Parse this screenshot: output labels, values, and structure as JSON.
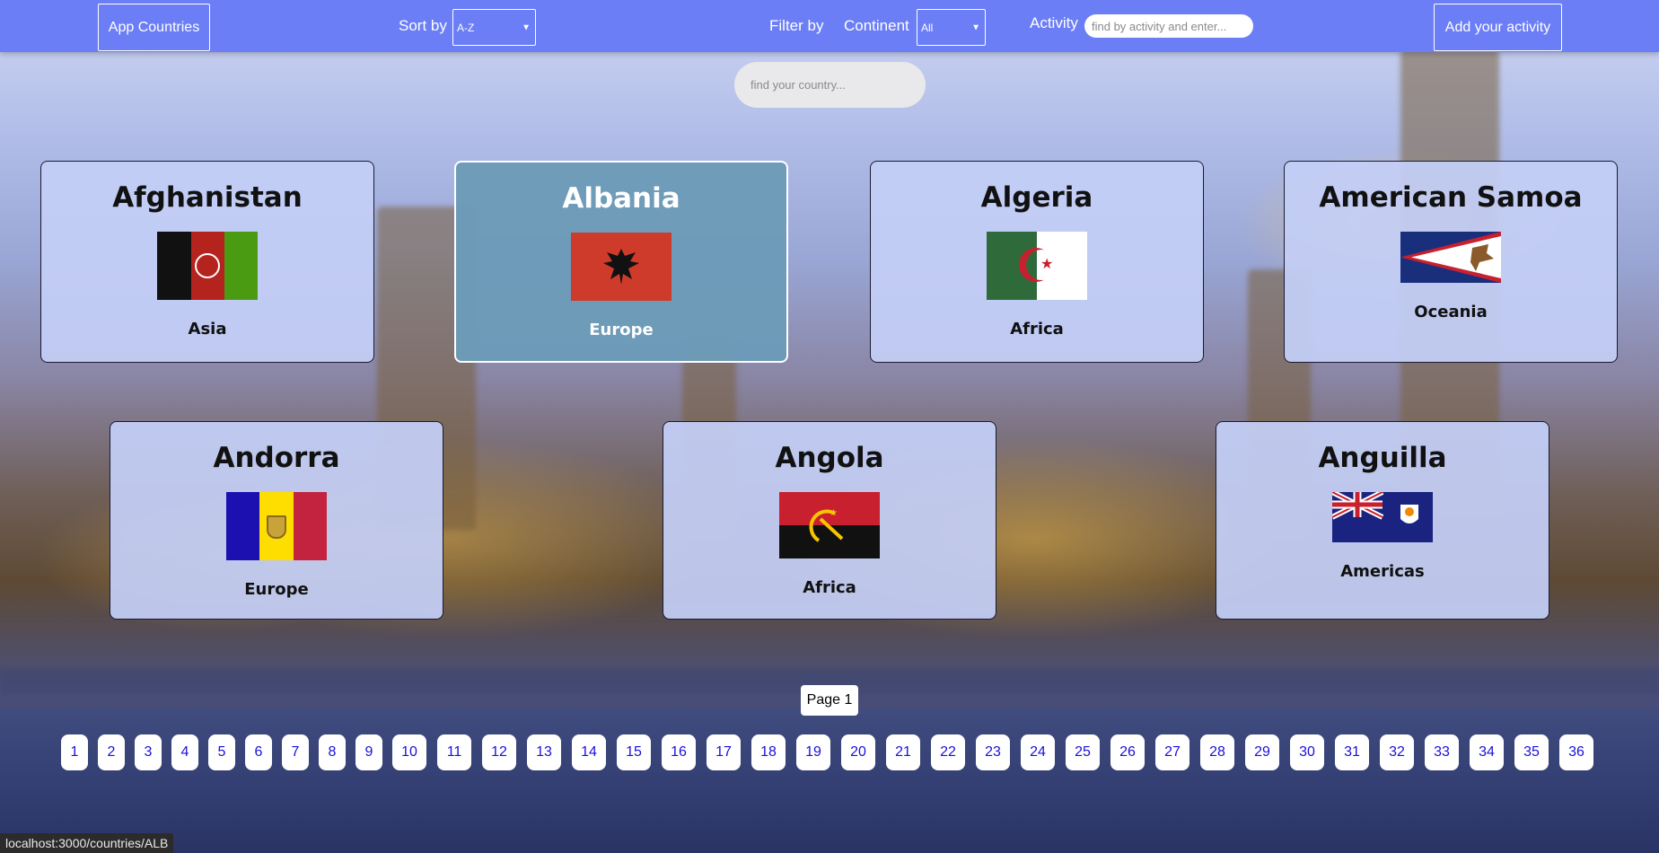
{
  "navbar": {
    "home_label": "App Countries",
    "sort_label": "Sort by",
    "sort_value": "A-Z",
    "filter_label": "Filter by",
    "continent_label": "Continent",
    "continent_value": "All",
    "activity_label": "Activity",
    "activity_placeholder": "find by activity and enter...",
    "add_activity_label": "Add your activity",
    "accent_color": "#6b7ef6"
  },
  "search": {
    "placeholder": "find your country..."
  },
  "countries": [
    {
      "name": "Afghanistan",
      "continent": "Asia",
      "flag": "afghanistan-flag-icon"
    },
    {
      "name": "Albania",
      "continent": "Europe",
      "flag": "albania-flag-icon",
      "hovered": true
    },
    {
      "name": "Algeria",
      "continent": "Africa",
      "flag": "algeria-flag-icon"
    },
    {
      "name": "American Samoa",
      "continent": "Oceania",
      "flag": "american-samoa-flag-icon"
    },
    {
      "name": "Andorra",
      "continent": "Europe",
      "flag": "andorra-flag-icon"
    },
    {
      "name": "Angola",
      "continent": "Africa",
      "flag": "angola-flag-icon"
    },
    {
      "name": "Anguilla",
      "continent": "Americas",
      "flag": "anguilla-flag-icon"
    }
  ],
  "pagination": {
    "current_label": "Page 1",
    "pages": [
      "1",
      "2",
      "3",
      "4",
      "5",
      "6",
      "7",
      "8",
      "9",
      "10",
      "11",
      "12",
      "13",
      "14",
      "15",
      "16",
      "17",
      "18",
      "19",
      "20",
      "21",
      "22",
      "23",
      "24",
      "25",
      "26",
      "27",
      "28",
      "29",
      "30",
      "31",
      "32",
      "33",
      "34",
      "35",
      "36"
    ]
  },
  "status_bar": {
    "url": "localhost:3000/countries/ALB"
  }
}
